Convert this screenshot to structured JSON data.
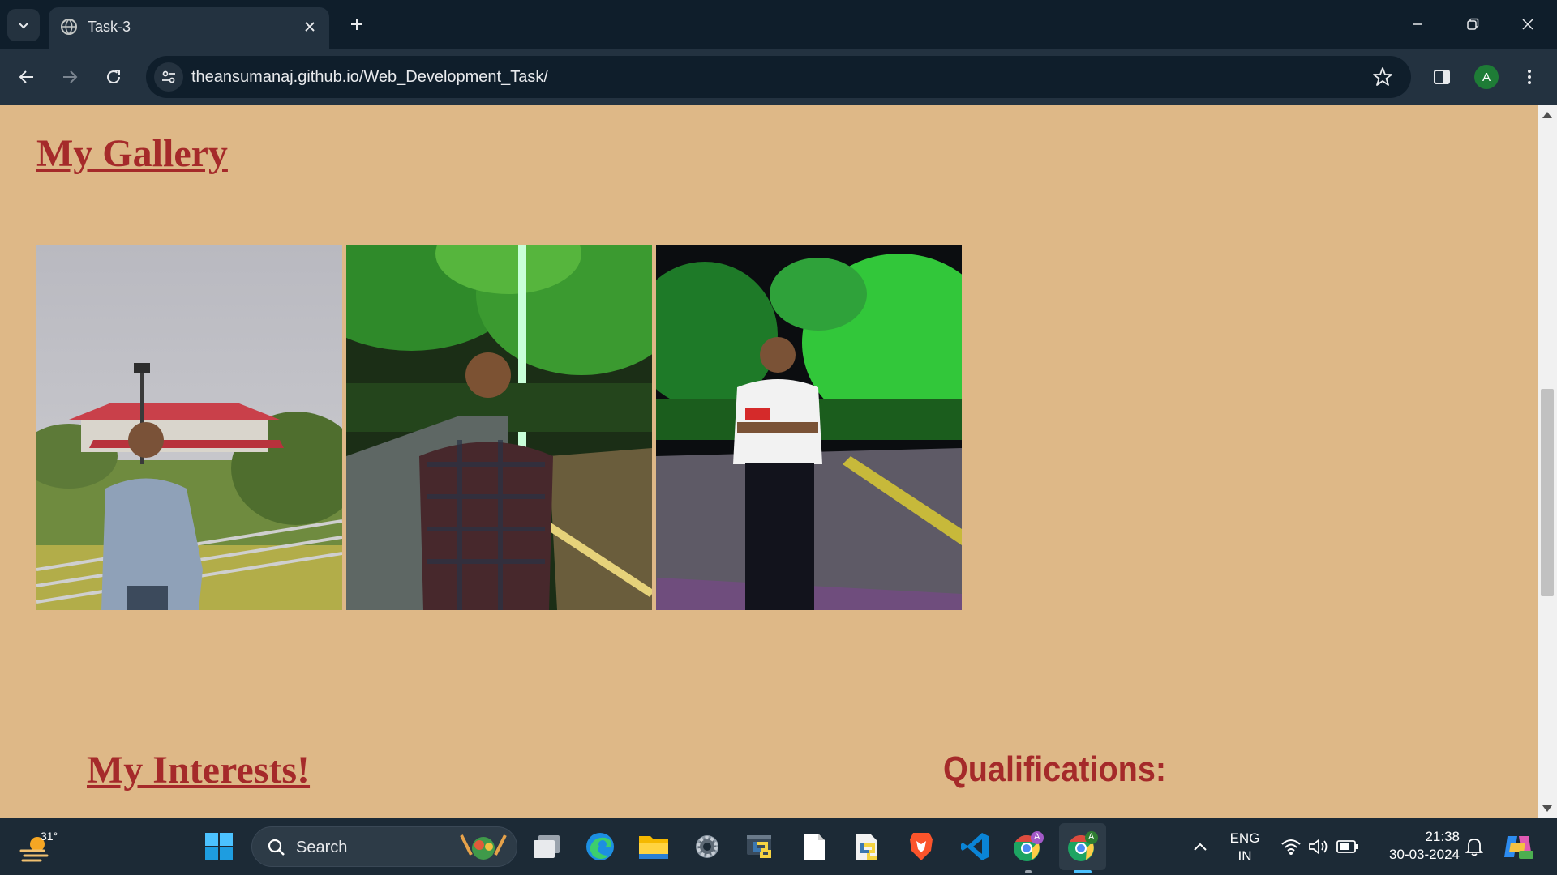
{
  "browser": {
    "tab": {
      "title": "Task-3"
    },
    "address_bar": {
      "url": "theansumanaj.github.io/Web_Development_Task/"
    },
    "profile_initial": "A"
  },
  "page": {
    "gallery_heading": "My Gallery",
    "gallery": [
      {
        "subject": "person-standing-near-pavilion",
        "name": "gallery-photo-1"
      },
      {
        "subject": "person-in-checked-shirt-at-night-park",
        "name": "gallery-photo-2"
      },
      {
        "subject": "person-with-arms-crossed-on-lit-road",
        "name": "gallery-photo-3"
      }
    ],
    "interests_heading": "My Interests!",
    "qualifications_heading": "Qualifications:"
  },
  "taskbar": {
    "weather_temp": "31°",
    "search_label": "Search",
    "language_line1": "ENG",
    "language_line2": "IN",
    "time": "21:38",
    "date": "30-03-2024",
    "chrome_profile_badge_1": "A",
    "chrome_profile_badge_2": "A"
  },
  "colors": {
    "page_background": "#deb887",
    "heading_color": "#a52a2a",
    "browser_frame": "#0f1e2b",
    "toolbar": "#233240"
  },
  "icons": [
    "tab-search-icon",
    "globe-icon",
    "close-icon",
    "plus-icon",
    "minimize-icon",
    "restore-icon",
    "back-icon",
    "forward-icon",
    "reload-icon",
    "site-info-icon",
    "star-icon",
    "side-panel-icon",
    "kebab-menu-icon",
    "windows-start-icon",
    "search-icon",
    "task-view-icon",
    "edge-icon",
    "file-explorer-icon",
    "settings-icon",
    "python-icon",
    "notepad-icon",
    "python-file-icon",
    "brave-icon",
    "vscode-icon",
    "chrome-icon",
    "wifi-icon",
    "volume-icon",
    "battery-icon",
    "bell-icon",
    "copilot-icon"
  ]
}
